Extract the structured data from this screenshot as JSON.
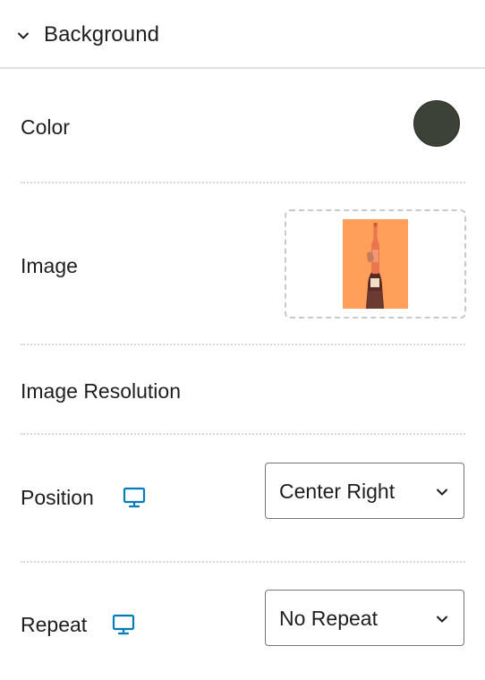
{
  "panel": {
    "title": "Background",
    "icons": {
      "collapse": "chevron-down-icon",
      "device": "desktop-monitor-icon",
      "dropdown": "chevron-down-icon"
    }
  },
  "color": {
    "label": "Color",
    "value": "#3d4239"
  },
  "image": {
    "label": "Image"
  },
  "image_resolution": {
    "label": "Image Resolution"
  },
  "position": {
    "label": "Position",
    "selected": "Center Right"
  },
  "repeat": {
    "label": "Repeat",
    "selected": "No Repeat"
  },
  "colors": {
    "accent": "#007cba",
    "thumb_bg": "#ff9f5a"
  }
}
